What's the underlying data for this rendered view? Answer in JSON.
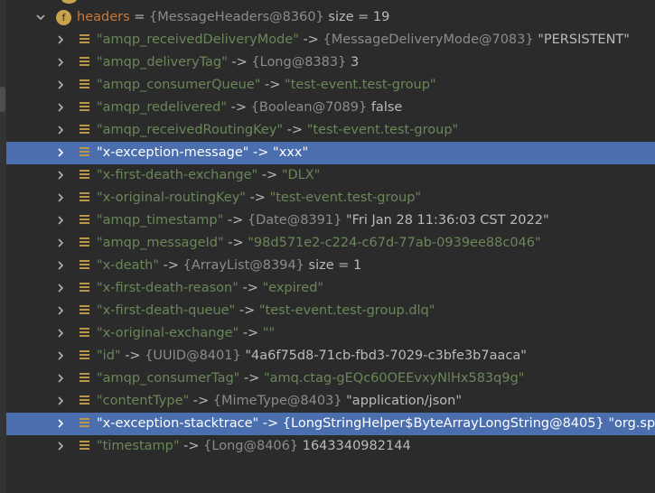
{
  "headers_node": {
    "name": "headers",
    "type": "{MessageHeaders@8360}",
    "size": "size = 19"
  },
  "entries": [
    {
      "key": "\"amqp_receivedDeliveryMode\"",
      "arrow": "->",
      "type": "{MessageDeliveryMode@7083}",
      "value": "\"PERSISTENT\"",
      "value_style": "val",
      "selected": false
    },
    {
      "key": "\"amqp_deliveryTag\"",
      "arrow": "->",
      "type": "{Long@8383}",
      "value": "3",
      "value_style": "val",
      "selected": false
    },
    {
      "key": "\"amqp_consumerQueue\"",
      "arrow": "->",
      "type": "",
      "value": "\"test-event.test-group\"",
      "value_style": "key",
      "selected": false
    },
    {
      "key": "\"amqp_redelivered\"",
      "arrow": "->",
      "type": "{Boolean@7089}",
      "value": "false",
      "value_style": "val",
      "selected": false
    },
    {
      "key": "\"amqp_receivedRoutingKey\"",
      "arrow": "->",
      "type": "",
      "value": "\"test-event.test-group\"",
      "value_style": "key",
      "selected": false
    },
    {
      "key": "\"x-exception-message\"",
      "arrow": "->",
      "type": "",
      "value": "\"xxx\"",
      "value_style": "key",
      "selected": true
    },
    {
      "key": "\"x-first-death-exchange\"",
      "arrow": "->",
      "type": "",
      "value": "\"DLX\"",
      "value_style": "key",
      "selected": false
    },
    {
      "key": "\"x-original-routingKey\"",
      "arrow": "->",
      "type": "",
      "value": "\"test-event.test-group\"",
      "value_style": "key",
      "selected": false
    },
    {
      "key": "\"amqp_timestamp\"",
      "arrow": "->",
      "type": "{Date@8391}",
      "value": "\"Fri Jan 28 11:36:03 CST 2022\"",
      "value_style": "val",
      "selected": false
    },
    {
      "key": "\"amqp_messageId\"",
      "arrow": "->",
      "type": "",
      "value": "\"98d571e2-c224-c67d-77ab-0939ee88c046\"",
      "value_style": "key",
      "selected": false
    },
    {
      "key": "\"x-death\"",
      "arrow": "->",
      "type": "{ArrayList@8394}",
      "value": " size = 1",
      "value_style": "val",
      "selected": false
    },
    {
      "key": "\"x-first-death-reason\"",
      "arrow": "->",
      "type": "",
      "value": "\"expired\"",
      "value_style": "key",
      "selected": false
    },
    {
      "key": "\"x-first-death-queue\"",
      "arrow": "->",
      "type": "",
      "value": "\"test-event.test-group.dlq\"",
      "value_style": "key",
      "selected": false
    },
    {
      "key": "\"x-original-exchange\"",
      "arrow": "->",
      "type": "",
      "value": "\"\"",
      "value_style": "key",
      "selected": false
    },
    {
      "key": "\"id\"",
      "arrow": "->",
      "type": "{UUID@8401}",
      "value": "\"4a6f75d8-71cb-fbd3-7029-c3bfe3b7aaca\"",
      "value_style": "val",
      "selected": false
    },
    {
      "key": "\"amqp_consumerTag\"",
      "arrow": "->",
      "type": "",
      "value": "\"amq.ctag-gEQc60OEEvxyNlHx583q9g\"",
      "value_style": "key",
      "selected": false
    },
    {
      "key": "\"contentType\"",
      "arrow": "->",
      "type": "{MimeType@8403}",
      "value": "\"application/json\"",
      "value_style": "val",
      "selected": false
    },
    {
      "key": "\"x-exception-stacktrace\"",
      "arrow": "->",
      "type": "{LongStringHelper$ByteArrayLongString@8405}",
      "value": "\"org.sp",
      "value_style": "val",
      "selected": true
    },
    {
      "key": "\"timestamp\"",
      "arrow": "->",
      "type": "{Long@8406}",
      "value": "1643340982144",
      "value_style": "val",
      "selected": false
    }
  ],
  "colors": {
    "background": "#2b2b2b",
    "selection": "#4b6eaf",
    "string": "#6a8759",
    "field": "#cc7832",
    "type": "#8c8c8c",
    "text": "#bbbbbb",
    "entry_icon": "#b8974a"
  },
  "icons": {
    "expand": "chevron-right-icon",
    "collapse": "chevron-down-icon",
    "field": "field-f-icon",
    "map_entry": "map-entry-icon"
  }
}
